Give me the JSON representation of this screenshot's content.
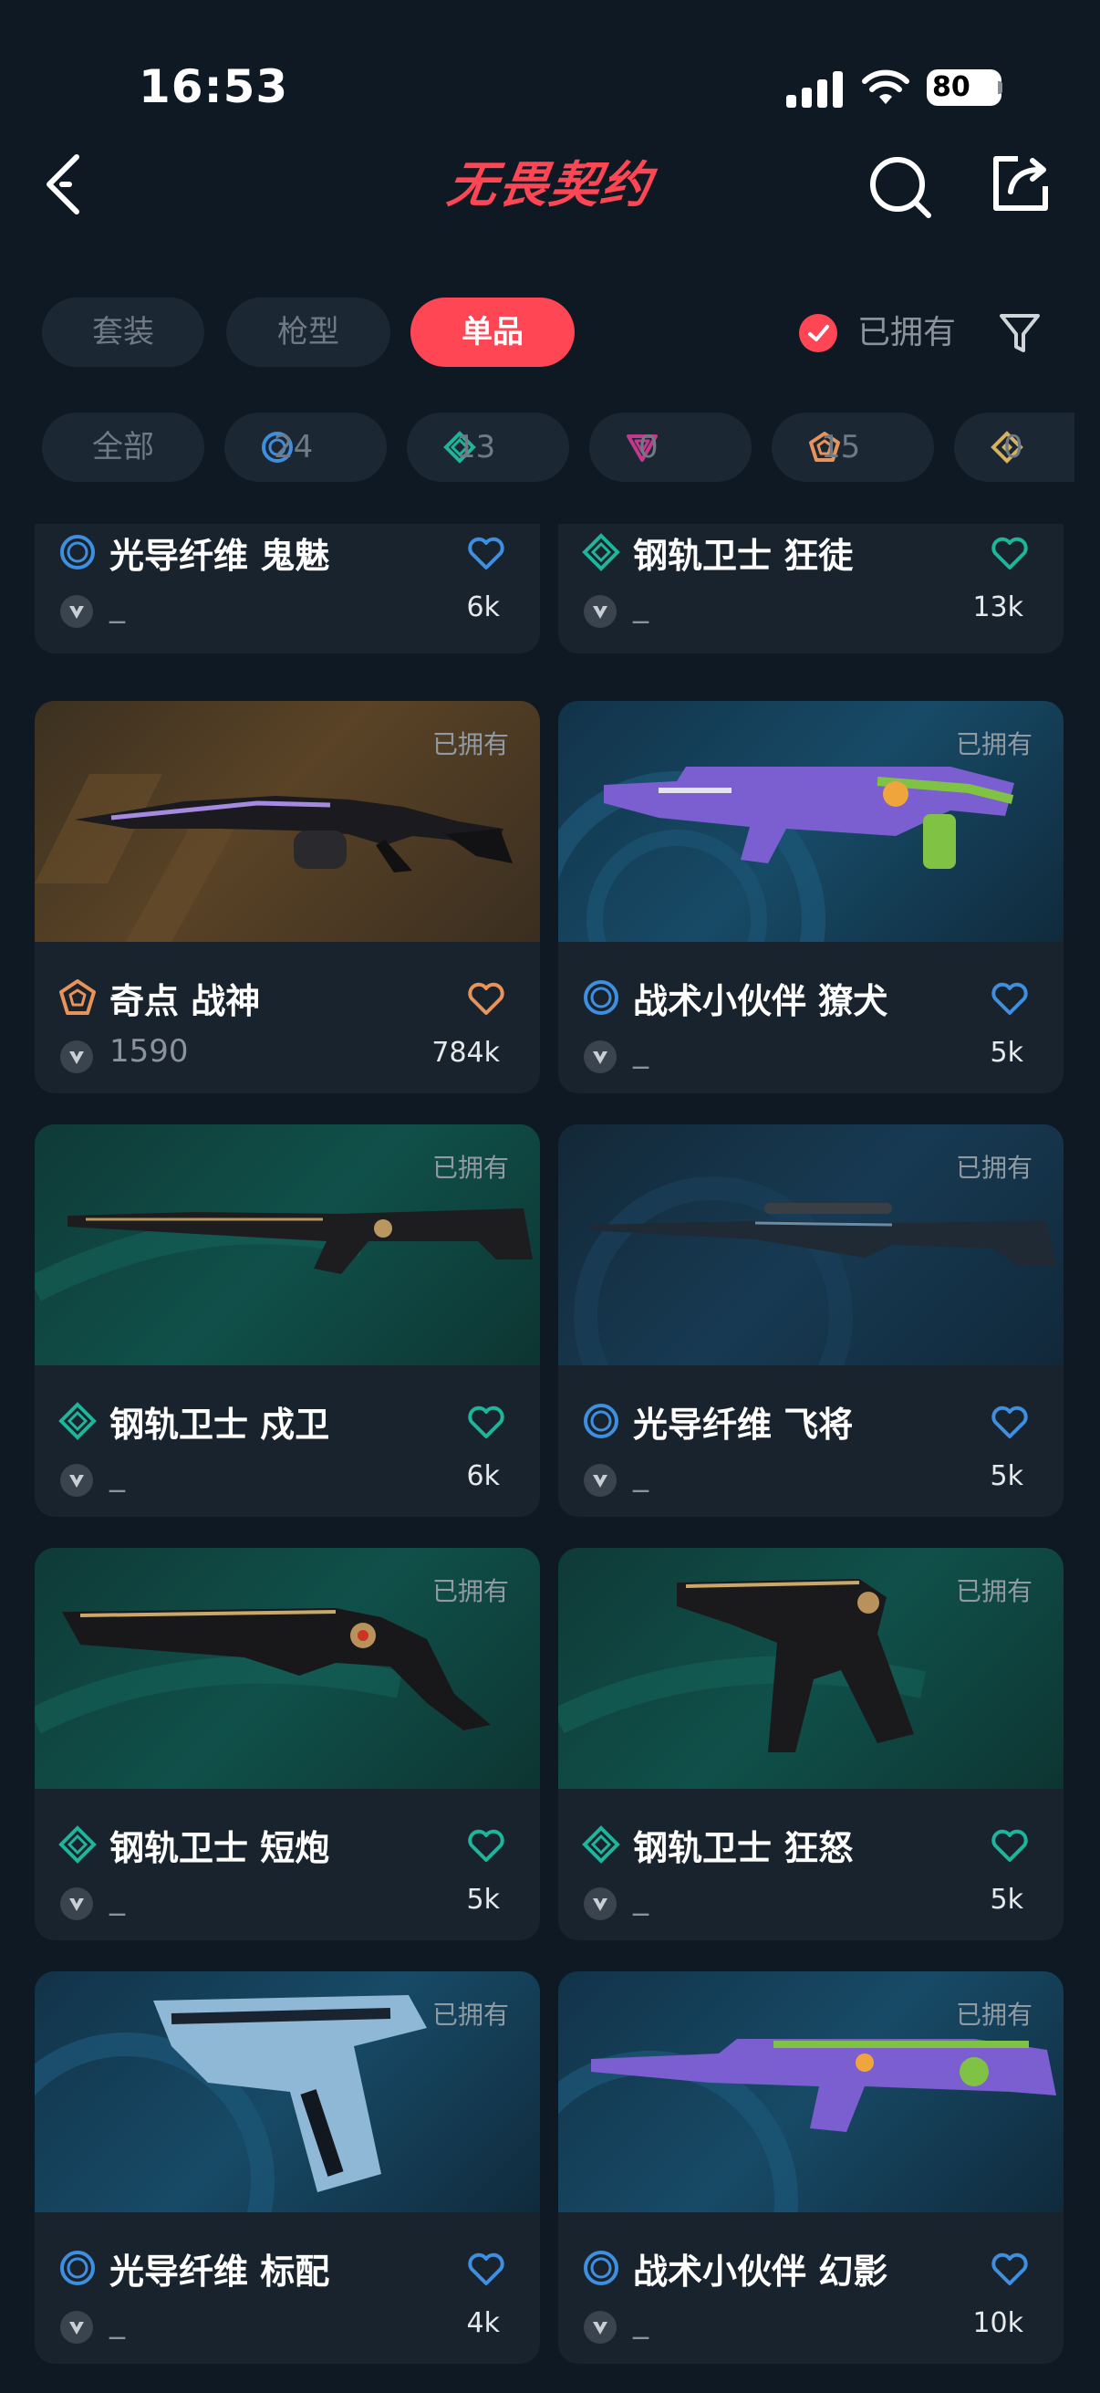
{
  "status_bar": {
    "time": "16:53",
    "battery": "80"
  },
  "nav": {
    "title": "无畏契约"
  },
  "tabs": [
    {
      "label": "套装",
      "active": false
    },
    {
      "label": "枪型",
      "active": false
    },
    {
      "label": "单品",
      "active": true
    }
  ],
  "owned_filter": {
    "label": "已拥有",
    "checked": true
  },
  "tier_chips": [
    {
      "label": "全部",
      "icon": "all"
    },
    {
      "label": "24",
      "icon": "select-tier-icon",
      "color": "#3f8fe0"
    },
    {
      "label": "13",
      "icon": "deluxe-tier-icon",
      "color": "#1fb59a"
    },
    {
      "label": "0",
      "icon": "premium-tier-icon",
      "color": "#c23a8c"
    },
    {
      "label": "15",
      "icon": "exclusive-tier-icon",
      "color": "#e8935a"
    },
    {
      "label": "0",
      "icon": "ultra-tier-icon",
      "color": "#d6b25c"
    }
  ],
  "colors": {
    "accent": "#ff4655",
    "select": "#3f8fe0",
    "deluxe": "#1fb59a",
    "exclusive": "#e8935a",
    "card_bg": "#19232d",
    "page_bg": "#0f1923"
  },
  "cards": [
    {
      "name": "光导纤维 鬼魅",
      "tier": "select",
      "price": "_",
      "likes": "6k",
      "owned_tag": ""
    },
    {
      "name": "钢轨卫士 狂徒",
      "tier": "deluxe",
      "price": "_",
      "likes": "13k",
      "owned_tag": ""
    },
    {
      "name": "奇点 战神",
      "tier": "exclusive",
      "price": "1590",
      "likes": "784k",
      "owned_tag": "已拥有"
    },
    {
      "name": "战术小伙伴 獠犬",
      "tier": "select",
      "price": "_",
      "likes": "5k",
      "owned_tag": "已拥有"
    },
    {
      "name": "钢轨卫士 戍卫",
      "tier": "deluxe",
      "price": "_",
      "likes": "6k",
      "owned_tag": "已拥有"
    },
    {
      "name": "光导纤维 飞将",
      "tier": "select",
      "price": "_",
      "likes": "5k",
      "owned_tag": "已拥有"
    },
    {
      "name": "钢轨卫士 短炮",
      "tier": "deluxe",
      "price": "_",
      "likes": "5k",
      "owned_tag": "已拥有"
    },
    {
      "name": "钢轨卫士 狂怒",
      "tier": "deluxe",
      "price": "_",
      "likes": "5k",
      "owned_tag": "已拥有"
    },
    {
      "name": "光导纤维 标配",
      "tier": "select",
      "price": "_",
      "likes": "4k",
      "owned_tag": "已拥有"
    },
    {
      "name": "战术小伙伴 幻影",
      "tier": "select",
      "price": "_",
      "likes": "10k",
      "owned_tag": "已拥有"
    }
  ]
}
